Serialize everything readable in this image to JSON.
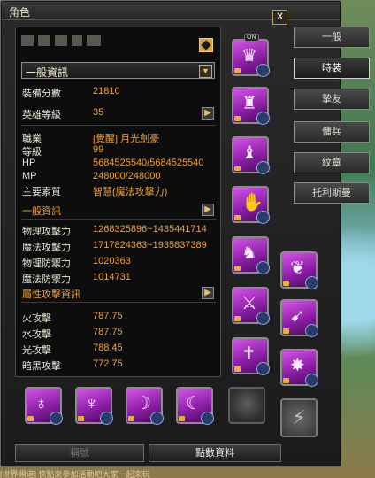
{
  "window": {
    "title": "角色",
    "close": "X"
  },
  "name_row": {
    "name": ""
  },
  "dropdown": {
    "selected": "一般資訊"
  },
  "stats_top": [
    {
      "label": "裝備分數",
      "value": "21810"
    },
    {
      "label": "英雄等級",
      "value": "35"
    }
  ],
  "stats_basic": [
    {
      "label": "職業",
      "value": "[覺醒] 月光劍豪"
    },
    {
      "label": "等級",
      "value": "99"
    },
    {
      "label": "HP",
      "value": "5684525540/5684525540"
    },
    {
      "label": "MP",
      "value": "248000/248000"
    },
    {
      "label": "主要素質",
      "value": "智慧(魔法攻擊力)"
    }
  ],
  "section_general": "一般資訊",
  "stats_combat": [
    {
      "label": "物理攻擊力",
      "value": "1268325896~1435441714"
    },
    {
      "label": "魔法攻擊力",
      "value": "1717824363~1935837389"
    },
    {
      "label": "物理防禦力",
      "value": "1020363"
    },
    {
      "label": "魔法防禦力",
      "value": "1014731"
    }
  ],
  "section_element": "屬性攻擊資訊",
  "stats_element": [
    {
      "label": "火攻擊",
      "value": "787.75"
    },
    {
      "label": "水攻擊",
      "value": "787.75"
    },
    {
      "label": "光攻擊",
      "value": "788.45"
    },
    {
      "label": "暗黑攻擊",
      "value": "772.75"
    }
  ],
  "tabs": [
    "一般",
    "時裝",
    "摯友",
    "傭兵",
    "紋章",
    "托利斯曼"
  ],
  "active_tab": "時裝",
  "slot_badge": "ON",
  "bottom_buttons": {
    "left": "稱號",
    "right": "點數資料"
  },
  "chat_line": "[世界頻道] 快點來參加活動吧大家一起來玩"
}
